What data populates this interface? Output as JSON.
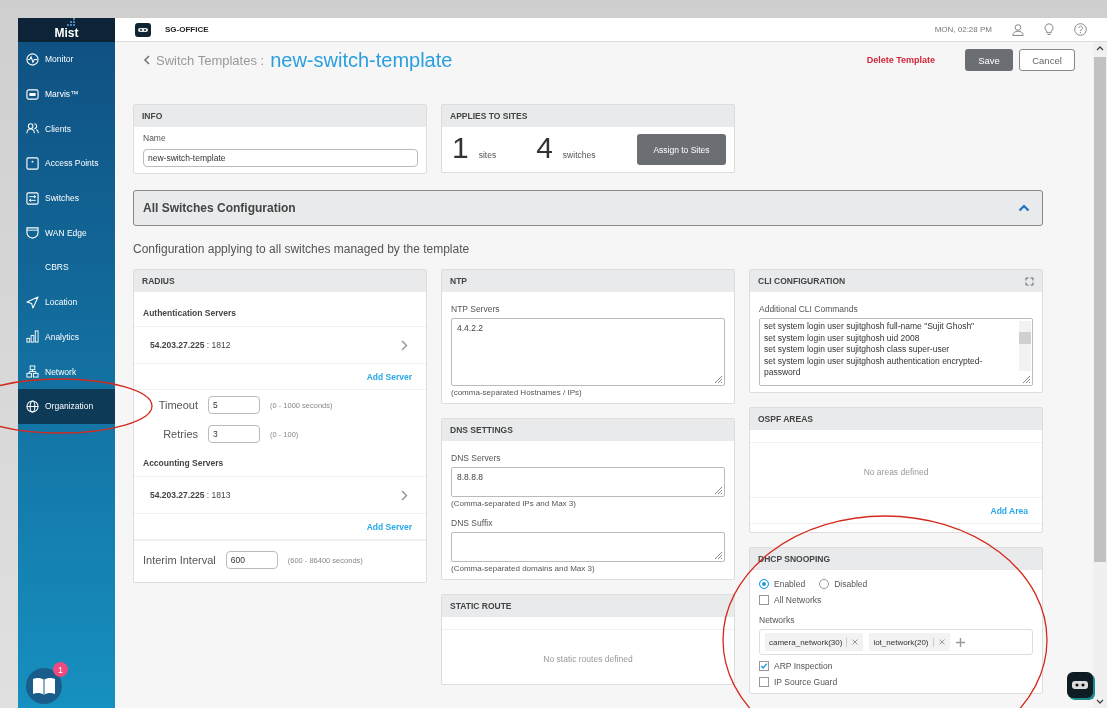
{
  "sidebar": {
    "logo": "Mist",
    "items": [
      {
        "label": "Monitor",
        "selected": false
      },
      {
        "label": "Marvis™",
        "selected": false
      },
      {
        "label": "Clients",
        "selected": false
      },
      {
        "label": "Access Points",
        "selected": false
      },
      {
        "label": "Switches",
        "selected": false
      },
      {
        "label": "WAN Edge",
        "selected": false
      },
      {
        "label": "CBRS",
        "selected": false
      },
      {
        "label": "Location",
        "selected": false
      },
      {
        "label": "Analytics",
        "selected": false
      },
      {
        "label": "Network",
        "selected": false
      },
      {
        "label": "Organization",
        "selected": true
      }
    ],
    "help_badge": "1"
  },
  "topbar": {
    "site": "SG-OFFICE",
    "time": "MON, 02:28 PM"
  },
  "header": {
    "breadcrumb": "Switch Templates :",
    "title": "new-switch-template",
    "delete": "Delete Template",
    "save": "Save",
    "cancel": "Cancel"
  },
  "info": {
    "title": "INFO",
    "name_label": "Name",
    "name_value": "new-switch-template"
  },
  "applies": {
    "title": "APPLIES TO SITES",
    "sites_count": "1",
    "sites_label": "sites",
    "switches_count": "4",
    "switches_label": "switches",
    "assign": "Assign to Sites"
  },
  "section": {
    "title": "All Switches Configuration",
    "expanded": true,
    "description": "Configuration applying to all switches managed by the template"
  },
  "radius": {
    "title": "RADIUS",
    "auth_heading": "Authentication Servers",
    "auth_server": {
      "ip": "54.203.27.225",
      "port": ": 1812"
    },
    "add_server_1": "Add Server",
    "timeout": {
      "label": "Timeout",
      "value": "5",
      "hint": "(0 - 1000 seconds)"
    },
    "retries": {
      "label": "Retries",
      "value": "3",
      "hint": "(0 - 100)"
    },
    "acct_heading": "Accounting Servers",
    "acct_server": {
      "ip": "54.203.27.225",
      "port": ": 1813"
    },
    "add_server_2": "Add Server",
    "interim": {
      "label": "Interim Interval",
      "value": "600",
      "hint": "(600 - 86400 seconds)"
    }
  },
  "ntp": {
    "title": "NTP",
    "label": "NTP Servers",
    "value": "4.4.2.2",
    "hint": "(comma-separated Hostnames / IPs)"
  },
  "dns": {
    "title": "DNS SETTINGS",
    "servers_label": "DNS Servers",
    "servers_value": "8.8.8.8",
    "servers_hint": "(Comma-separated IPs and Max 3)",
    "suffix_label": "DNS Suffix",
    "suffix_hint": "(Comma-separated domains and Max 3)"
  },
  "static_route": {
    "title": "STATIC ROUTE",
    "empty": "No static routes defined"
  },
  "cli": {
    "title": "CLI CONFIGURATION",
    "label": "Additional CLI Commands",
    "lines": [
      "set system login user sujitghosh full-name \"Sujit Ghosh\"",
      "set system login user sujitghosh  uid 2008",
      "set system login user sujitghosh class super-user",
      "set system login user sujitghosh authentication encrypted-password"
    ]
  },
  "ospf": {
    "title": "OSPF AREAS",
    "empty": "No areas defined",
    "add": "Add Area"
  },
  "dhcp": {
    "title": "DHCP SNOOPING",
    "radios": [
      {
        "label": "Enabled",
        "selected": true
      },
      {
        "label": "Disabled",
        "selected": false
      }
    ],
    "all_networks": {
      "label": "All Networks",
      "checked": false
    },
    "networks_label": "Networks",
    "networks": [
      "camera_network(30)",
      "iot_network(20)"
    ],
    "options": [
      {
        "label": "ARP Inspection",
        "checked": true
      },
      {
        "label": "IP Source Guard",
        "checked": false
      }
    ]
  }
}
